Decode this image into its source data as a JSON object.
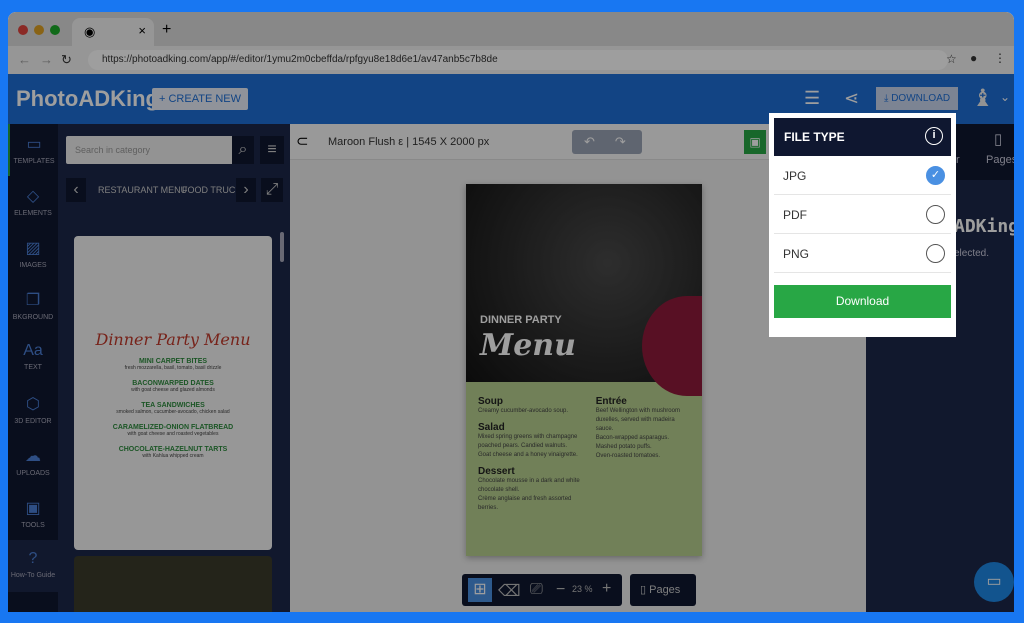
{
  "browser": {
    "tab_close": "×",
    "new_tab": "+",
    "url": "https://photoadking.com/app/#/editor/1ymu2m0cbeffda/rpfgyu8e18d6e1/av47anb5c7b8de"
  },
  "header": {
    "logo": "PhotoADKing",
    "create_new": "+ CREATE NEW",
    "download": "DOWNLOAD"
  },
  "sidebar": {
    "items": [
      {
        "label": "TEMPLATES",
        "icon": "▭"
      },
      {
        "label": "ELEMENTS",
        "icon": "◇"
      },
      {
        "label": "IMAGES",
        "icon": "▨"
      },
      {
        "label": "BKGROUND",
        "icon": "❐"
      },
      {
        "label": "TEXT",
        "icon": "Aa"
      },
      {
        "label": "3D EDITOR",
        "icon": "⬡"
      },
      {
        "label": "UPLOADS",
        "icon": "☁"
      },
      {
        "label": "TOOLS",
        "icon": "▣"
      },
      {
        "label": "How-To Guide",
        "icon": "?"
      }
    ]
  },
  "panel": {
    "search_placeholder": "Search in category",
    "categories": [
      "RESTAURANT MENU",
      "FOOD TRUCK"
    ],
    "template": {
      "title": "Dinner Party Menu",
      "items": [
        {
          "name": "MINI CARPET BITES",
          "desc": "fresh mozzarella, basil, tomato, basil drizzle"
        },
        {
          "name": "BACONWARPED DATES",
          "desc": "with goat cheese and glazed almonds"
        },
        {
          "name": "TEA SANDWICHES",
          "desc": "smoked salmon, cucumber-avocado, chicken salad"
        },
        {
          "name": "CARAMELIZED-ONION FLATBREAD",
          "desc": "with goat cheese and roasted vegetables"
        },
        {
          "name": "CHOCOLATE-HAZELNUT TARTS",
          "desc": "with Kahlua whipped cream"
        }
      ]
    }
  },
  "canvas": {
    "doc_title": "Maroon Flush ε | 1545 X 2000 px",
    "zoom": "23 %",
    "pages": "Pages",
    "poster": {
      "kicker": "DINNER PARTY",
      "title": "Menu",
      "left": [
        {
          "h": "Soup",
          "t": [
            "Creamy cucumber-avocado soup."
          ]
        },
        {
          "h": "Salad",
          "t": [
            "Mixed spring greens with champagne poached pears. Candied walnuts.",
            "Goat cheese and a honey vinaigrette."
          ]
        },
        {
          "h": "Dessert",
          "t": [
            "Chocolate mousse in a dark and white chocolate shell.",
            "Crème anglaise and fresh assorted berries."
          ]
        }
      ],
      "right": {
        "h": "Entrée",
        "t": [
          "Beef Wellington with mushroom duxelles, served with madeira sauce.",
          "Bacon-wrapped asparagus.",
          "Mashed potato puffs.",
          "Oven-roasted tomatoes."
        ]
      }
    }
  },
  "right_panel": {
    "tab_partial": "r",
    "pages": "Pages",
    "brand_partial": "ADKing",
    "note_partial": "elected."
  },
  "file_type": {
    "title": "FILE TYPE",
    "options": [
      {
        "label": "JPG",
        "selected": true
      },
      {
        "label": "PDF",
        "selected": false
      },
      {
        "label": "PNG",
        "selected": false
      }
    ],
    "download": "Download",
    "check": "✓"
  },
  "colors": {
    "header": "#1e6ed6",
    "dark": "#0f1730",
    "download_green": "#28a745",
    "selected": "#4a90e2"
  }
}
